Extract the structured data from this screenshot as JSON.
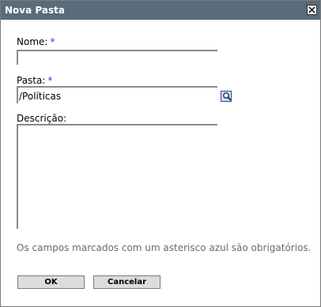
{
  "dialog": {
    "title": "Nova Pasta",
    "close_icon": "close-icon"
  },
  "form": {
    "name_label": "Nome:",
    "name_required": "*",
    "name_value": "",
    "folder_label": "Pasta:",
    "folder_required": "*",
    "folder_value": "/Políticas",
    "browse_icon": "magnifier-icon",
    "description_label": "Descrição:",
    "description_value": ""
  },
  "note": "Os campos marcados com um asterisco azul são obrigatórios.",
  "buttons": {
    "ok": "OK",
    "cancel": "Cancelar"
  },
  "colors": {
    "titlebar": "#5a6b79",
    "required_asterisk": "#1c45c5",
    "note_text": "#6a6a6a"
  }
}
